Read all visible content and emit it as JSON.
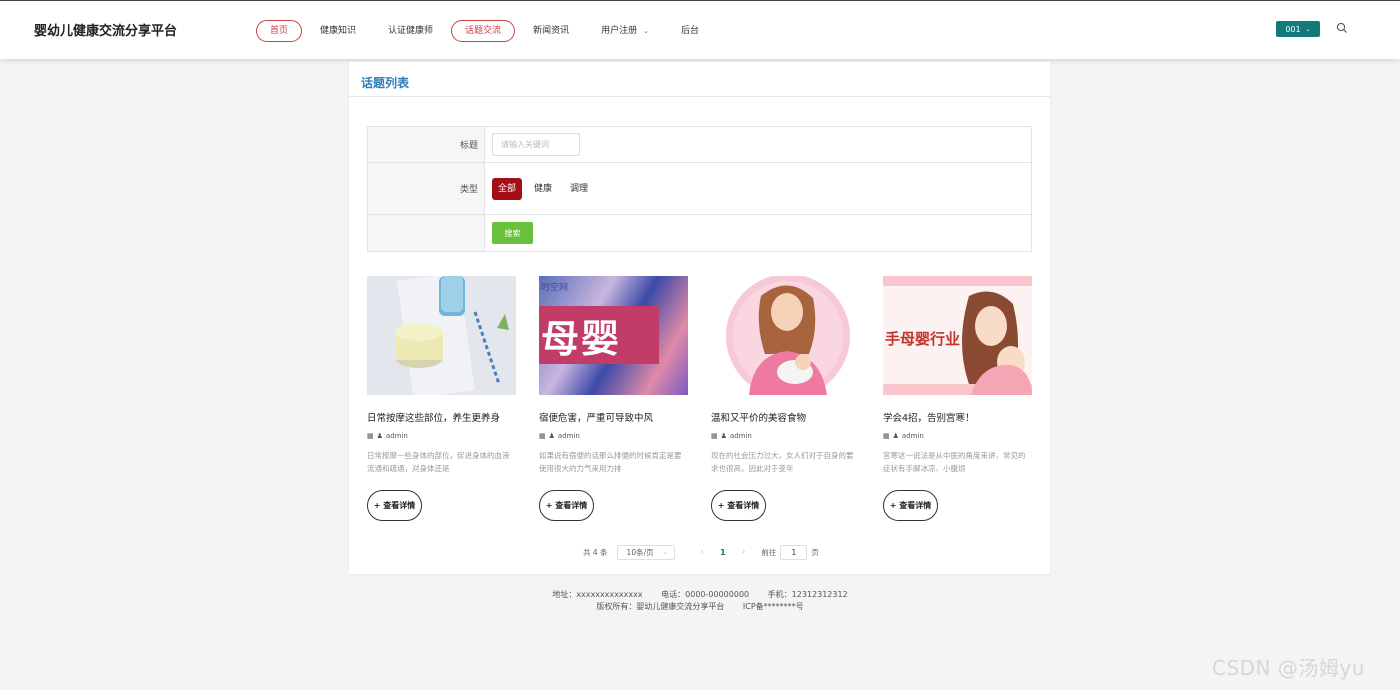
{
  "header": {
    "brand": "婴幼儿健康交流分享平台",
    "nav": [
      "首页",
      "健康知识",
      "认证健康师",
      "话题交流",
      "新闻资讯",
      "用户注册",
      "后台"
    ],
    "user_label": "001"
  },
  "main": {
    "title": "话题列表",
    "filter": {
      "title_label": "标题",
      "title_placeholder": "请输入关键词",
      "type_label": "类型",
      "types": [
        "全部",
        "健康",
        "调理"
      ],
      "search_label": "搜索"
    },
    "items": [
      {
        "title": "日常按摩这些部位，养生更养身",
        "author": "admin",
        "desc": "日常按摩一些身体的部位，促进身体的血液流通和疏通，对身体还是"
      },
      {
        "title": "宿便危害，严重可导致中风",
        "author": "admin",
        "desc": "如果说有宿便的话那么排便的时候肯定是要使用很大的力气来用力排"
      },
      {
        "title": "温和又平价的美容食物",
        "author": "admin",
        "desc": "现在的社会压力过大，女人们对于自身的要求也很高，因此对于变年"
      },
      {
        "title": "学会4招，告别宫寒！",
        "author": "admin",
        "desc": "宫寒这一说法是从中医的角度来讲，常见的症状有手脚冰凉、小腹烦"
      }
    ],
    "detail_label": "+ 查看详情",
    "image_texts": {
      "img2_banner": "母婴",
      "img2_top": "时空网",
      "img4_banner": "手母婴行业"
    },
    "pagination": {
      "total": "共 4 条",
      "page_size": "10条/页",
      "current": "1",
      "goto": "前往",
      "goto_value": "1",
      "page_unit": "页"
    }
  },
  "footer": {
    "address": "地址：xxxxxxxxxxxxxx",
    "phone": "电话：0000-00000000",
    "mobile": "手机：12312312312",
    "copyright": "版权所有：婴幼儿健康交流分享平台",
    "icp": "ICP备********号"
  },
  "watermark": "CSDN @汤姆yu",
  "colors": {
    "accent": "#117a7a",
    "nav_active": "#c9433e",
    "type_active": "#a30f14",
    "search_btn": "#67c23a",
    "title_blue": "#2d7fb8"
  }
}
